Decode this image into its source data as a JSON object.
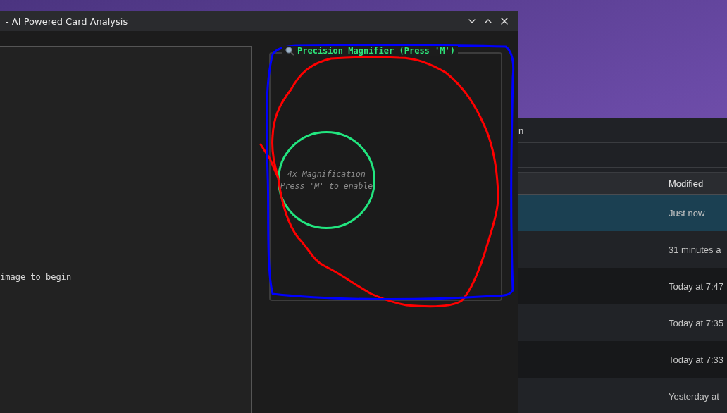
{
  "main_window": {
    "title": "- AI Powered Card Analysis"
  },
  "image_panel": {
    "message": "image to begin"
  },
  "magnifier": {
    "title": "Precision Magnifier (Press 'M')",
    "lines": [
      "4x Magnification",
      "Press 'M' to enable"
    ]
  },
  "file_window": {
    "title": "n",
    "columns": [
      "Modified"
    ],
    "rows": [
      {
        "modified": "Just now",
        "selected": true
      },
      {
        "modified": "31 minutes a",
        "selected": false
      },
      {
        "modified": "Today at 7:47",
        "selected": false
      },
      {
        "modified": "Today at 7:35",
        "selected": false
      },
      {
        "modified": "Today at 7:33",
        "selected": false
      },
      {
        "modified": "Yesterday at",
        "selected": false
      }
    ]
  },
  "annotations": [
    {
      "kind": "loop",
      "color": "#ff0000"
    },
    {
      "kind": "rectangle",
      "color": "#0000ff"
    }
  ]
}
